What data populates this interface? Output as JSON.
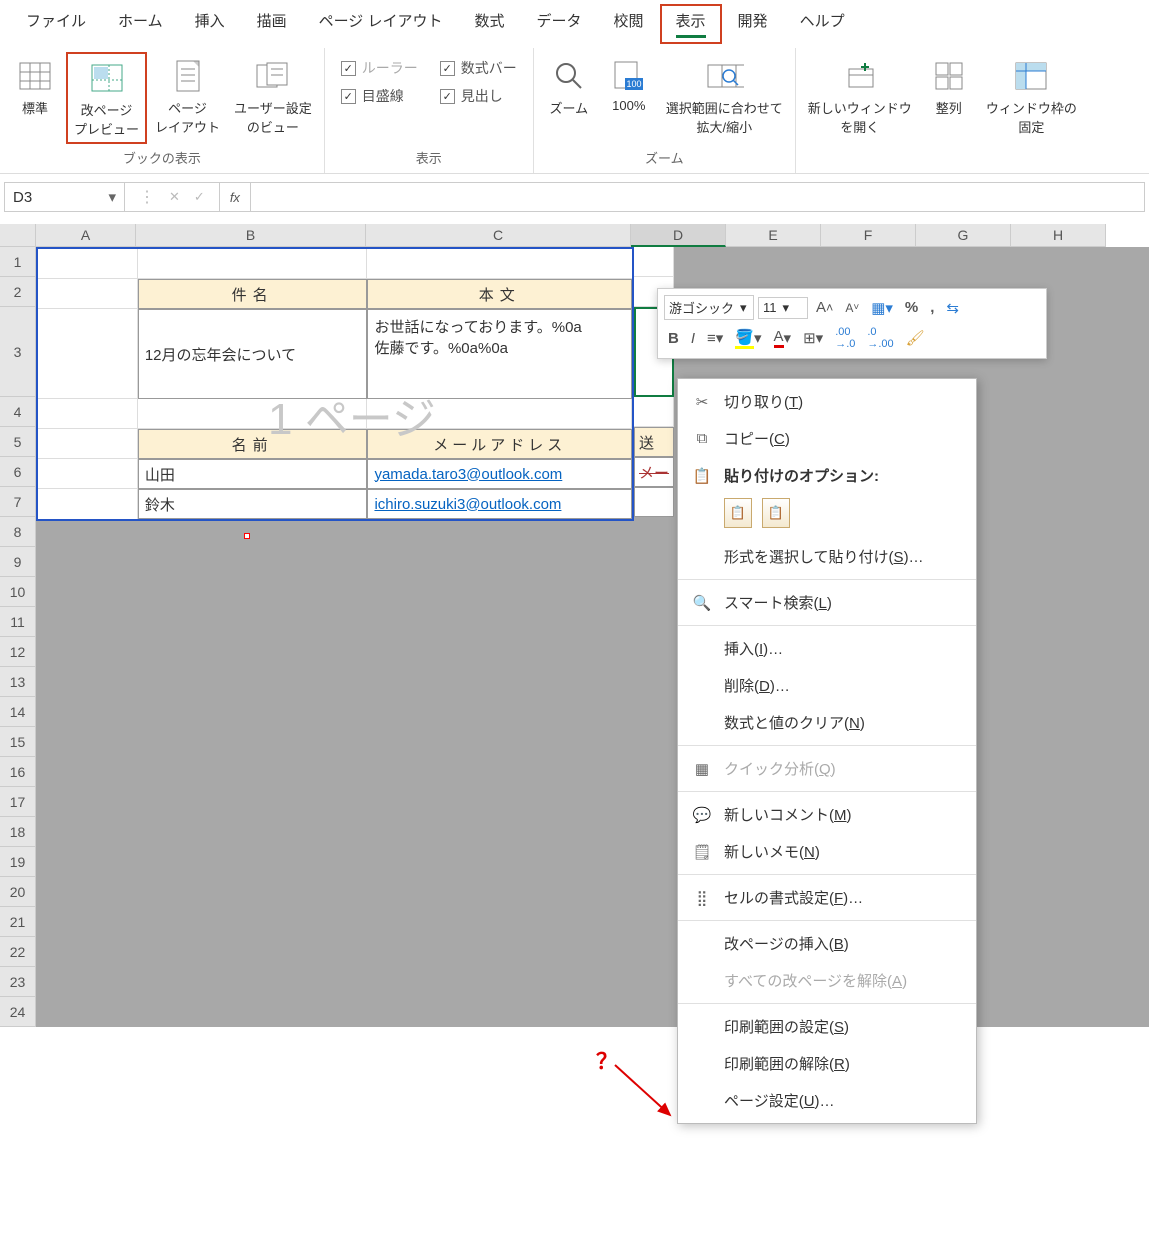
{
  "menubar": [
    "ファイル",
    "ホーム",
    "挿入",
    "描画",
    "ページ レイアウト",
    "数式",
    "データ",
    "校閲",
    "表示",
    "開発",
    "ヘルプ"
  ],
  "menubar_active_index": 8,
  "ribbon": {
    "group_book_views": {
      "label": "ブックの表示",
      "btns": [
        {
          "t": "標準"
        },
        {
          "t": "改ページ\nプレビュー"
        },
        {
          "t": "ページ\nレイアウト"
        },
        {
          "t": "ユーザー設定\nのビュー"
        }
      ]
    },
    "group_show": {
      "label": "表示",
      "checks": [
        {
          "t": "ルーラー",
          "on": true,
          "disabled": true
        },
        {
          "t": "数式バー",
          "on": true
        },
        {
          "t": "目盛線",
          "on": true
        },
        {
          "t": "見出し",
          "on": true
        }
      ]
    },
    "group_zoom": {
      "label": "ズーム",
      "btns": [
        {
          "t": "ズーム"
        },
        {
          "t": "100%"
        },
        {
          "t": "選択範囲に合わせて\n拡大/縮小"
        }
      ]
    },
    "group_window": {
      "btns": [
        {
          "t": "新しいウィンドウ\nを開く"
        },
        {
          "t": "整列"
        },
        {
          "t": "ウィンドウ枠の\n固定"
        }
      ]
    }
  },
  "name_box": "D3",
  "columns": [
    "A",
    "B",
    "C",
    "D",
    "E",
    "F",
    "G",
    "H"
  ],
  "active_col_index": 3,
  "rows": [
    1,
    2,
    3,
    4,
    5,
    6,
    7,
    8,
    9,
    10,
    11,
    12,
    13,
    14,
    15,
    16,
    17,
    18,
    19,
    20,
    21,
    22,
    23,
    24
  ],
  "watermark": "1 ページ",
  "table1": {
    "h1": "件名",
    "h2": "本文",
    "b1": "12月の忘年会について",
    "b2": "お世話になっております。%0a\n佐藤です。%0a%0a"
  },
  "table2": {
    "h1": "名前",
    "h2": "メールアドレス",
    "h3": "送",
    "rows": [
      {
        "name": "山田",
        "mail": "yamada.taro3@outlook.com",
        "d": "メー"
      },
      {
        "name": "鈴木",
        "mail": "ichiro.suzuki3@outlook.com",
        "d": ""
      }
    ]
  },
  "mini": {
    "font": "游ゴシック",
    "size": "11"
  },
  "ctx": [
    {
      "icon": "cut",
      "t": "切り取り",
      "k": "T"
    },
    {
      "icon": "copy",
      "t": "コピー",
      "k": "C"
    },
    {
      "icon": "paste",
      "t": "貼り付けのオプション:",
      "bold": true,
      "paste_opts": true
    },
    {
      "t": "形式を選択して貼り付け",
      "k": "S",
      "suffix": "…"
    },
    {
      "sep": true
    },
    {
      "icon": "search",
      "t": "スマート検索",
      "k": "L"
    },
    {
      "sep": true
    },
    {
      "t": "挿入",
      "k": "I",
      "suffix": "…"
    },
    {
      "t": "削除",
      "k": "D",
      "suffix": "…"
    },
    {
      "t": "数式と値のクリア",
      "k": "N"
    },
    {
      "sep": true
    },
    {
      "icon": "quick",
      "t": "クイック分析",
      "k": "Q",
      "disabled": true
    },
    {
      "sep": true
    },
    {
      "icon": "comment",
      "t": "新しいコメント",
      "k": "M"
    },
    {
      "icon": "note",
      "t": "新しいメモ",
      "k": "N"
    },
    {
      "sep": true
    },
    {
      "icon": "format",
      "t": "セルの書式設定",
      "k": "F",
      "suffix": "…"
    },
    {
      "sep": true
    },
    {
      "t": "改ページの挿入",
      "k": "B"
    },
    {
      "t": "すべての改ページを解除",
      "k": "A",
      "disabled": true
    },
    {
      "sep": true
    },
    {
      "t": "印刷範囲の設定",
      "k": "S"
    },
    {
      "t": "印刷範囲の解除",
      "k": "R"
    },
    {
      "t": "ページ設定",
      "k": "U",
      "suffix": "…"
    }
  ],
  "annotation_q": "？"
}
